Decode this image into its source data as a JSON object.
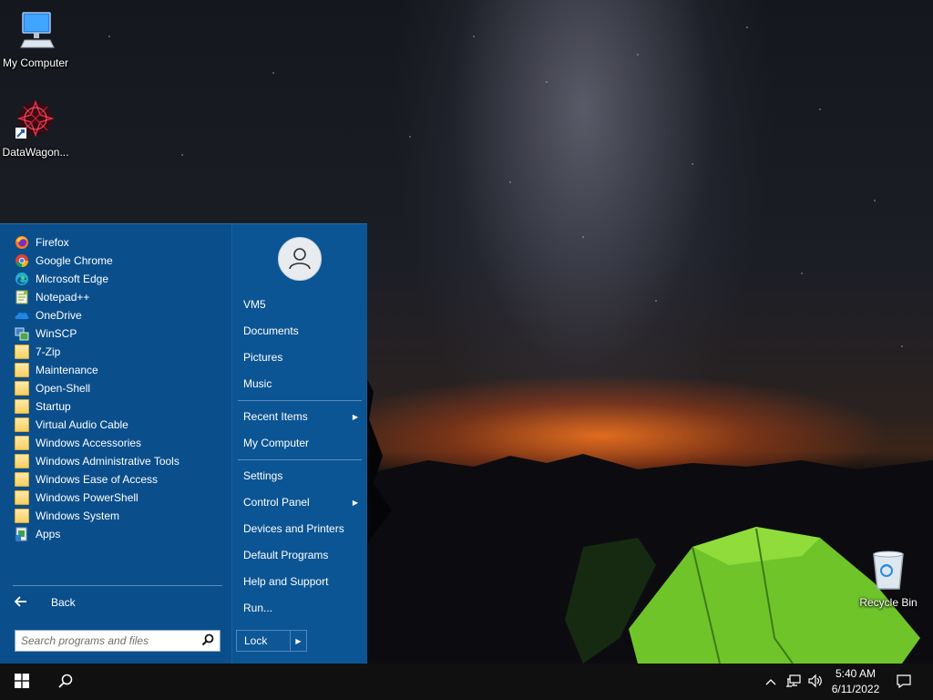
{
  "desktop": {
    "icons": [
      {
        "label": "My Computer",
        "icon": "monitor-icon"
      },
      {
        "label": "DataWagon...",
        "icon": "datawagon-logo-icon"
      },
      {
        "label": "Recycle Bin",
        "icon": "recycle-bin-icon"
      }
    ]
  },
  "start_menu": {
    "programs": [
      {
        "label": "Firefox",
        "icon": "firefox-icon"
      },
      {
        "label": "Google Chrome",
        "icon": "chrome-icon"
      },
      {
        "label": "Microsoft Edge",
        "icon": "edge-icon"
      },
      {
        "label": "Notepad++",
        "icon": "notepadpp-icon"
      },
      {
        "label": "OneDrive",
        "icon": "onedrive-icon"
      },
      {
        "label": "WinSCP",
        "icon": "winscp-icon"
      },
      {
        "label": "7-Zip",
        "icon": "folder-icon"
      },
      {
        "label": "Maintenance",
        "icon": "folder-icon"
      },
      {
        "label": "Open-Shell",
        "icon": "folder-icon"
      },
      {
        "label": "Startup",
        "icon": "folder-icon"
      },
      {
        "label": "Virtual Audio Cable",
        "icon": "folder-icon"
      },
      {
        "label": "Windows Accessories",
        "icon": "folder-icon"
      },
      {
        "label": "Windows Administrative Tools",
        "icon": "folder-icon"
      },
      {
        "label": "Windows Ease of Access",
        "icon": "folder-icon"
      },
      {
        "label": "Windows PowerShell",
        "icon": "folder-icon"
      },
      {
        "label": "Windows System",
        "icon": "folder-icon"
      },
      {
        "label": "Apps",
        "icon": "apps-icon"
      }
    ],
    "back_label": "Back",
    "search_placeholder": "Search programs and files",
    "right": {
      "user": "VM5",
      "documents": "Documents",
      "pictures": "Pictures",
      "music": "Music",
      "recent_items": "Recent Items",
      "my_computer": "My Computer",
      "settings": "Settings",
      "control_panel": "Control Panel",
      "devices_printers": "Devices and Printers",
      "default_programs": "Default Programs",
      "help_support": "Help and Support",
      "run": "Run...",
      "lock": "Lock"
    }
  },
  "taskbar": {
    "time": "5:40 AM",
    "date": "6/11/2022"
  },
  "colors": {
    "start_menu_bg": "#0a4f8c",
    "taskbar_bg": "#101010"
  }
}
